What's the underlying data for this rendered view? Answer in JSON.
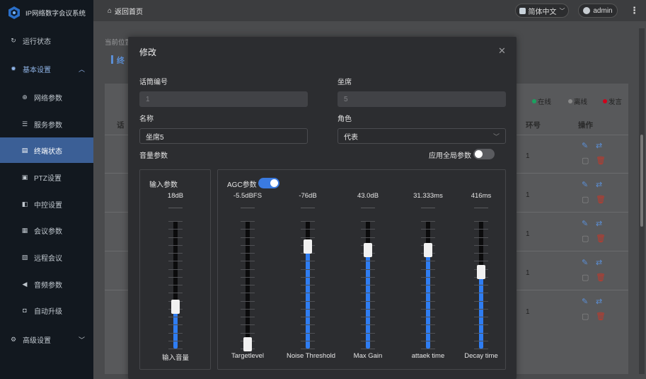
{
  "app": {
    "title": "IP网络数字会议系统"
  },
  "sidebar": {
    "items": [
      {
        "label": "运行状态",
        "icon": "refresh-icon"
      },
      {
        "label": "基本设置",
        "icon": "gear-icon",
        "state": "open"
      },
      {
        "label": "网络参数",
        "icon": "globe-icon"
      },
      {
        "label": "服务参数",
        "icon": "server-icon"
      },
      {
        "label": "终端状态",
        "icon": "terminal-icon",
        "state": "active"
      },
      {
        "label": "PTZ设置",
        "icon": "camera-icon"
      },
      {
        "label": "中控设置",
        "icon": "control-icon"
      },
      {
        "label": "会议参数",
        "icon": "meeting-icon"
      },
      {
        "label": "远程会议",
        "icon": "remote-icon"
      },
      {
        "label": "音频参数",
        "icon": "speaker-icon"
      },
      {
        "label": "自动升级",
        "icon": "upgrade-icon"
      },
      {
        "label": "高级设置",
        "icon": "settings-icon"
      }
    ]
  },
  "header": {
    "home_label": "返回首页",
    "language": "简体中文",
    "user": "admin"
  },
  "background": {
    "breadcrumb_prefix": "当前位置",
    "page_title_fragment": "终",
    "legend": [
      {
        "label": "在线",
        "color": "#1aa260"
      },
      {
        "label": "离线",
        "color": "#888888"
      },
      {
        "label": "发言",
        "color": "#d0021b"
      }
    ],
    "columns": [
      "话",
      "环号",
      "操作"
    ],
    "rows": [
      {
        "ring": "1"
      },
      {
        "ring": "1"
      },
      {
        "ring": "1"
      },
      {
        "ring": "1"
      },
      {
        "ring": "1"
      }
    ]
  },
  "modal": {
    "title": "修改",
    "fields": {
      "mic_id_label": "话筒编号",
      "mic_id_value": "1",
      "seat_label": "坐席",
      "seat_value": "5",
      "name_label": "名称",
      "name_value": "坐席5",
      "role_label": "角色",
      "role_value": "代表"
    },
    "volume_section_label": "音量参数",
    "apply_global_label": "应用全局参数",
    "apply_global_on": false,
    "input_panel": {
      "title": "输入参数",
      "fader": {
        "value": "18dB",
        "name": "输入音量",
        "level": 0.33
      }
    },
    "agc_panel": {
      "title": "AGC参数",
      "enabled": true,
      "faders": [
        {
          "value": "-5.5dBFS",
          "name": "Targetlevel",
          "level": 0.0
        },
        {
          "value": "-76dB",
          "name": "Noise Threshold",
          "level": 0.8
        },
        {
          "value": "43.0dB",
          "name": "Max Gain",
          "level": 0.77
        },
        {
          "value": "31.333ms",
          "name": "attaek time",
          "level": 0.77
        },
        {
          "value": "416ms",
          "name": "Decay time",
          "level": 0.6
        }
      ]
    }
  },
  "colors": {
    "accent": "#2f7df2",
    "sidebar_active": "#3b5f96",
    "modal_bg": "#2c2d30"
  }
}
